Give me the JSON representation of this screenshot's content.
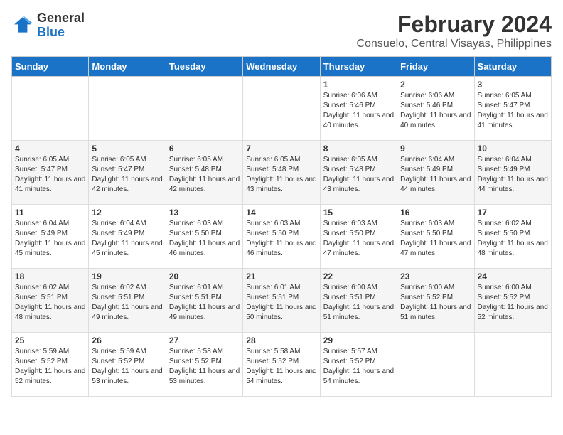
{
  "header": {
    "logo_line1": "General",
    "logo_line2": "Blue",
    "main_title": "February 2024",
    "sub_title": "Consuelo, Central Visayas, Philippines"
  },
  "days_of_week": [
    "Sunday",
    "Monday",
    "Tuesday",
    "Wednesday",
    "Thursday",
    "Friday",
    "Saturday"
  ],
  "weeks": [
    [
      {
        "day": "",
        "info": ""
      },
      {
        "day": "",
        "info": ""
      },
      {
        "day": "",
        "info": ""
      },
      {
        "day": "",
        "info": ""
      },
      {
        "day": "1",
        "info": "Sunrise: 6:06 AM\nSunset: 5:46 PM\nDaylight: 11 hours and 40 minutes."
      },
      {
        "day": "2",
        "info": "Sunrise: 6:06 AM\nSunset: 5:46 PM\nDaylight: 11 hours and 40 minutes."
      },
      {
        "day": "3",
        "info": "Sunrise: 6:05 AM\nSunset: 5:47 PM\nDaylight: 11 hours and 41 minutes."
      }
    ],
    [
      {
        "day": "4",
        "info": "Sunrise: 6:05 AM\nSunset: 5:47 PM\nDaylight: 11 hours and 41 minutes."
      },
      {
        "day": "5",
        "info": "Sunrise: 6:05 AM\nSunset: 5:47 PM\nDaylight: 11 hours and 42 minutes."
      },
      {
        "day": "6",
        "info": "Sunrise: 6:05 AM\nSunset: 5:48 PM\nDaylight: 11 hours and 42 minutes."
      },
      {
        "day": "7",
        "info": "Sunrise: 6:05 AM\nSunset: 5:48 PM\nDaylight: 11 hours and 43 minutes."
      },
      {
        "day": "8",
        "info": "Sunrise: 6:05 AM\nSunset: 5:48 PM\nDaylight: 11 hours and 43 minutes."
      },
      {
        "day": "9",
        "info": "Sunrise: 6:04 AM\nSunset: 5:49 PM\nDaylight: 11 hours and 44 minutes."
      },
      {
        "day": "10",
        "info": "Sunrise: 6:04 AM\nSunset: 5:49 PM\nDaylight: 11 hours and 44 minutes."
      }
    ],
    [
      {
        "day": "11",
        "info": "Sunrise: 6:04 AM\nSunset: 5:49 PM\nDaylight: 11 hours and 45 minutes."
      },
      {
        "day": "12",
        "info": "Sunrise: 6:04 AM\nSunset: 5:49 PM\nDaylight: 11 hours and 45 minutes."
      },
      {
        "day": "13",
        "info": "Sunrise: 6:03 AM\nSunset: 5:50 PM\nDaylight: 11 hours and 46 minutes."
      },
      {
        "day": "14",
        "info": "Sunrise: 6:03 AM\nSunset: 5:50 PM\nDaylight: 11 hours and 46 minutes."
      },
      {
        "day": "15",
        "info": "Sunrise: 6:03 AM\nSunset: 5:50 PM\nDaylight: 11 hours and 47 minutes."
      },
      {
        "day": "16",
        "info": "Sunrise: 6:03 AM\nSunset: 5:50 PM\nDaylight: 11 hours and 47 minutes."
      },
      {
        "day": "17",
        "info": "Sunrise: 6:02 AM\nSunset: 5:50 PM\nDaylight: 11 hours and 48 minutes."
      }
    ],
    [
      {
        "day": "18",
        "info": "Sunrise: 6:02 AM\nSunset: 5:51 PM\nDaylight: 11 hours and 48 minutes."
      },
      {
        "day": "19",
        "info": "Sunrise: 6:02 AM\nSunset: 5:51 PM\nDaylight: 11 hours and 49 minutes."
      },
      {
        "day": "20",
        "info": "Sunrise: 6:01 AM\nSunset: 5:51 PM\nDaylight: 11 hours and 49 minutes."
      },
      {
        "day": "21",
        "info": "Sunrise: 6:01 AM\nSunset: 5:51 PM\nDaylight: 11 hours and 50 minutes."
      },
      {
        "day": "22",
        "info": "Sunrise: 6:00 AM\nSunset: 5:51 PM\nDaylight: 11 hours and 51 minutes."
      },
      {
        "day": "23",
        "info": "Sunrise: 6:00 AM\nSunset: 5:52 PM\nDaylight: 11 hours and 51 minutes."
      },
      {
        "day": "24",
        "info": "Sunrise: 6:00 AM\nSunset: 5:52 PM\nDaylight: 11 hours and 52 minutes."
      }
    ],
    [
      {
        "day": "25",
        "info": "Sunrise: 5:59 AM\nSunset: 5:52 PM\nDaylight: 11 hours and 52 minutes."
      },
      {
        "day": "26",
        "info": "Sunrise: 5:59 AM\nSunset: 5:52 PM\nDaylight: 11 hours and 53 minutes."
      },
      {
        "day": "27",
        "info": "Sunrise: 5:58 AM\nSunset: 5:52 PM\nDaylight: 11 hours and 53 minutes."
      },
      {
        "day": "28",
        "info": "Sunrise: 5:58 AM\nSunset: 5:52 PM\nDaylight: 11 hours and 54 minutes."
      },
      {
        "day": "29",
        "info": "Sunrise: 5:57 AM\nSunset: 5:52 PM\nDaylight: 11 hours and 54 minutes."
      },
      {
        "day": "",
        "info": ""
      },
      {
        "day": "",
        "info": ""
      }
    ]
  ]
}
